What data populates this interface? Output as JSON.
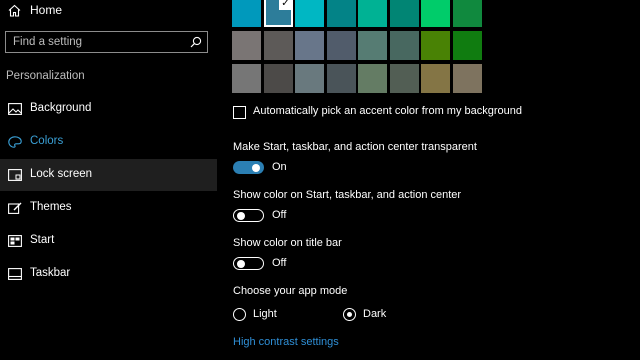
{
  "sidebar": {
    "home_label": "Home",
    "search_placeholder": "Find a setting",
    "section_title": "Personalization",
    "items": [
      {
        "label": "Background",
        "icon": "image-icon"
      },
      {
        "label": "Colors",
        "icon": "palette-icon"
      },
      {
        "label": "Lock screen",
        "icon": "lock-screen-icon"
      },
      {
        "label": "Themes",
        "icon": "themes-icon"
      },
      {
        "label": "Start",
        "icon": "start-icon"
      },
      {
        "label": "Taskbar",
        "icon": "taskbar-icon"
      }
    ],
    "active_item": "Colors"
  },
  "colors": {
    "swatch_rows": [
      [
        "#0099bc",
        "#2d7d9a",
        "#00b7c3",
        "#038387",
        "#00b294",
        "#018574",
        "#00cc6a",
        "#10893e"
      ],
      [
        "#7a7574",
        "#5d5a58",
        "#68768a",
        "#515c6b",
        "#567c73",
        "#486860",
        "#498205",
        "#107c10"
      ],
      [
        "#767676",
        "#4c4a48",
        "#69797e",
        "#4a5459",
        "#647c64",
        "#525e54",
        "#847545",
        "#7e735f"
      ]
    ],
    "selected_swatch": "#2d7d9a",
    "accent": "#2b7fb3",
    "link_color": "#2f8fd6"
  },
  "main": {
    "auto_pick_label": "Automatically pick an accent color from my background",
    "auto_pick_checked": false,
    "transparent_label": "Make Start, taskbar, and action center transparent",
    "transparent_state": "On",
    "show_color_start_label": "Show color on Start, taskbar, and action center",
    "show_color_start_state": "Off",
    "show_color_title_label": "Show color on title bar",
    "show_color_title_state": "Off",
    "app_mode_label": "Choose your app mode",
    "app_mode_options": [
      "Light",
      "Dark"
    ],
    "app_mode_selected": "Dark",
    "high_contrast_link": "High contrast settings"
  }
}
